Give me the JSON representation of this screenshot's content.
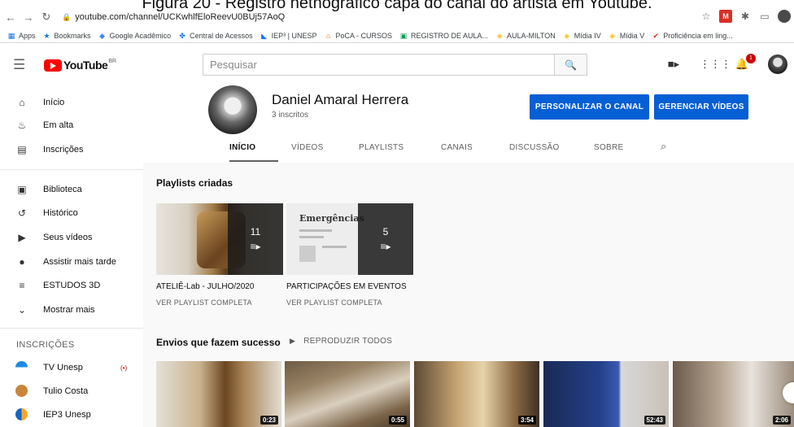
{
  "caption": "Figura 20 - Registro netnográfico capa do canal do artista em Youtube.",
  "browser": {
    "url": "youtube.com/channel/UCKwhlfEloReevU0BUj57AoQ",
    "bookmarks": [
      "Apps",
      "Bookmarks",
      "Google Acadêmico",
      "Central de Acessos",
      "IEP³ | UNESP",
      "PoCA - CURSOS",
      "REGISTRO DE AULA...",
      "AULA-MILTON",
      "Mídia IV",
      "Mídia V",
      "Proficiência em ling..."
    ]
  },
  "header": {
    "logo_text": "YouTube",
    "logo_region": "BR",
    "search_placeholder": "Pesquisar",
    "notification_count": "1"
  },
  "sidebar": {
    "main": [
      {
        "label": "Início",
        "icon": "home-icon"
      },
      {
        "label": "Em alta",
        "icon": "flame-icon"
      },
      {
        "label": "Inscrições",
        "icon": "subscriptions-icon"
      }
    ],
    "library": [
      {
        "label": "Biblioteca",
        "icon": "library-icon"
      },
      {
        "label": "Histórico",
        "icon": "history-icon"
      },
      {
        "label": "Seus vídeos",
        "icon": "your-videos-icon"
      },
      {
        "label": "Assistir mais tarde",
        "icon": "watch-later-icon"
      },
      {
        "label": "ESTUDOS 3D",
        "icon": "playlist-icon"
      },
      {
        "label": "Mostrar mais",
        "icon": "chevron-down-icon"
      }
    ],
    "subs_title": "INSCRIÇÕES",
    "subscriptions": [
      {
        "label": "TV Unesp",
        "live": "(•)"
      },
      {
        "label": "Tulio Costa",
        "live": ""
      },
      {
        "label": "IEP3 Unesp",
        "live": ""
      }
    ]
  },
  "channel": {
    "name": "Daniel Amaral Herrera",
    "subscribers": "3 inscritos",
    "customize_label": "PERSONALIZAR O CANAL",
    "manage_label": "GERENCIAR VÍDEOS",
    "tabs": [
      "INÍCIO",
      "VÍDEOS",
      "PLAYLISTS",
      "CANAIS",
      "DISCUSSÃO",
      "SOBRE"
    ]
  },
  "playlists": {
    "title": "Playlists criadas",
    "items": [
      {
        "title": "ATELIÊ-Lab - JULHO/2020",
        "count": "11",
        "link": "VER PLAYLIST COMPLETA"
      },
      {
        "title": "PARTICIPAÇÕES EM EVENTOS",
        "count": "5",
        "link": "VER PLAYLIST COMPLETA",
        "thumb_text": "Emergências"
      }
    ]
  },
  "popular": {
    "title": "Envios que fazem sucesso",
    "play_all": "REPRODUZIR TODOS",
    "durations": [
      "0:23",
      "0:55",
      "3:54",
      "52:43",
      "2:06"
    ]
  }
}
